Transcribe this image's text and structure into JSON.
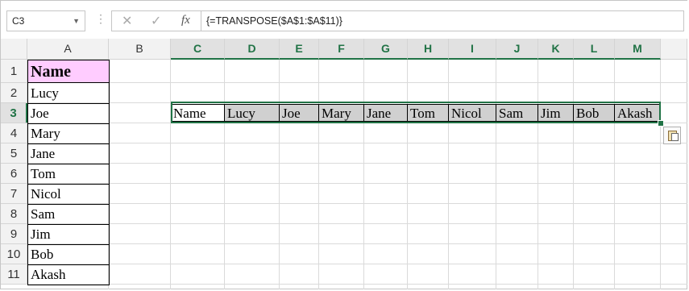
{
  "formula_bar": {
    "name_box": "C3",
    "cancel_icon": "✕",
    "enter_icon": "✓",
    "fx_label": "fx",
    "formula": "{=TRANSPOSE($A$1:$A$11)}"
  },
  "columns": [
    "A",
    "B",
    "C",
    "D",
    "E",
    "F",
    "G",
    "H",
    "I",
    "J",
    "K",
    "L",
    "M"
  ],
  "rows": [
    "1",
    "2",
    "3",
    "4",
    "5",
    "6",
    "7",
    "8",
    "9",
    "10",
    "11"
  ],
  "column_a": {
    "header": "Name",
    "header_fill": "#ffccff",
    "names": [
      "Lucy",
      "Joe",
      "Mary",
      "Jane",
      "Tom",
      "Nicol",
      "Sam",
      "Jim",
      "Bob",
      "Akash"
    ]
  },
  "transposed_row": [
    "Name",
    "Lucy",
    "Joe",
    "Mary",
    "Jane",
    "Tom",
    "Nicol",
    "Sam",
    "Jim",
    "Bob",
    "Akash"
  ],
  "colors": {
    "accent": "#217346",
    "shade": "#d0d0d0"
  },
  "icons": {
    "paste_options": "paste-options-icon"
  }
}
